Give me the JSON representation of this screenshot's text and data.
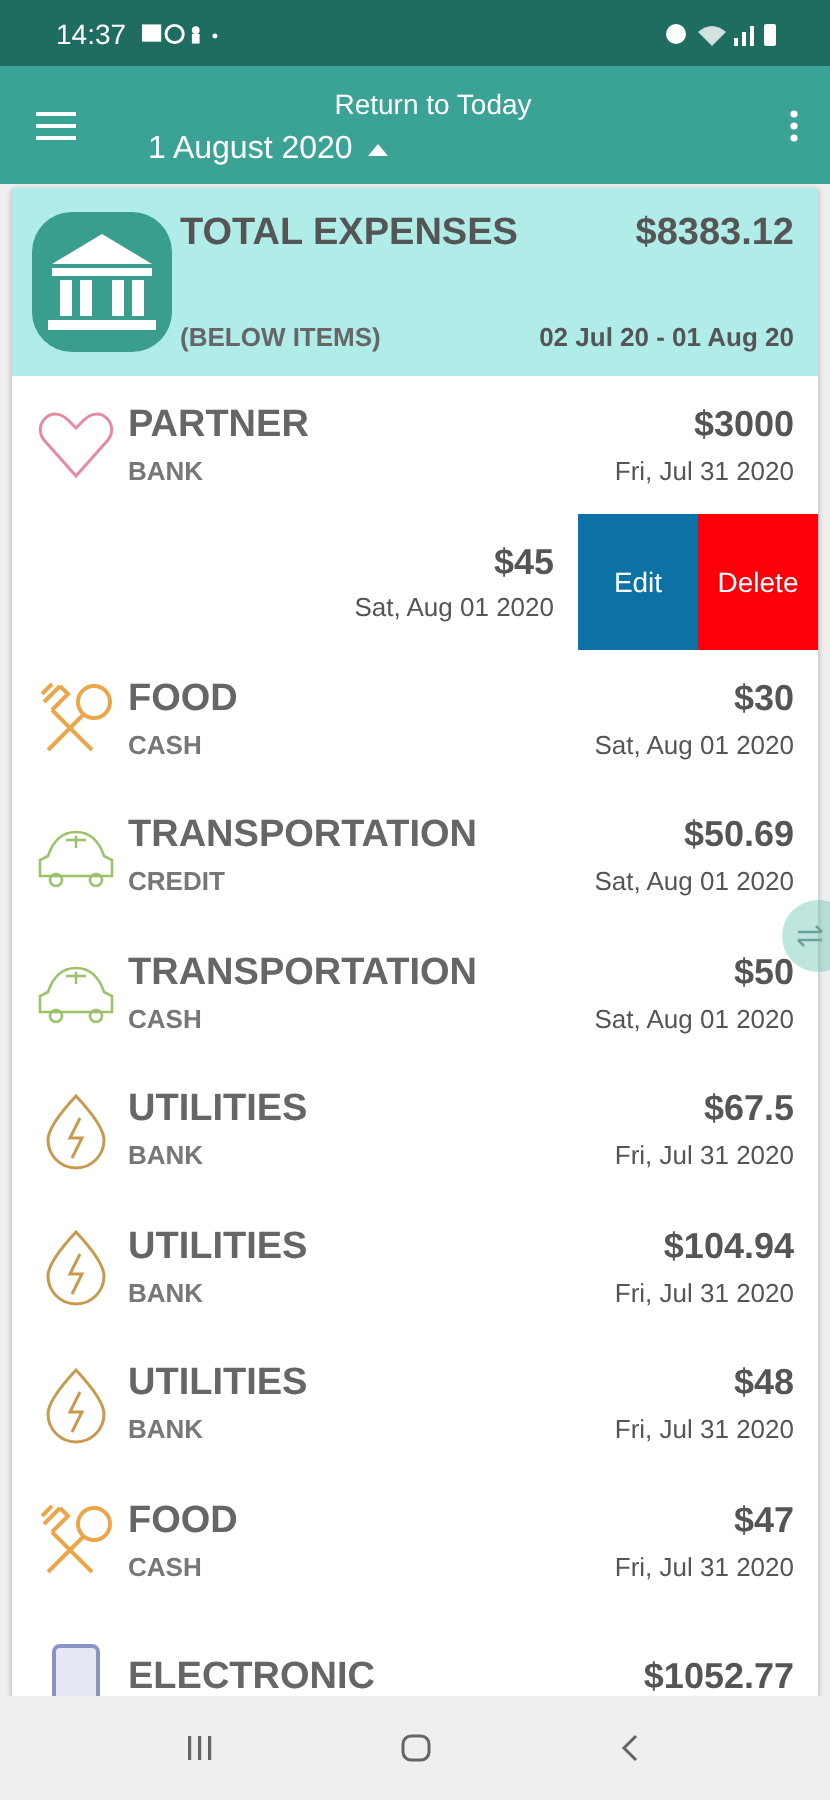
{
  "status_bar": {
    "time": "14:37"
  },
  "app_bar": {
    "title": "Return to Today",
    "date": "1 August 2020"
  },
  "summary": {
    "title": "TOTAL EXPENSES",
    "amount": "$8383.12",
    "subtitle": "(BELOW ITEMS)",
    "range": "02 Jul 20 - 01 Aug 20"
  },
  "items": [
    {
      "kind": "heart",
      "name": "PARTNER",
      "account": "BANK",
      "amount": "$3000",
      "date": "Fri, Jul 31 2020"
    },
    {
      "kind": "swiped",
      "amount": "$45",
      "date": "Sat, Aug 01 2020",
      "actions": [
        "Edit",
        "Delete"
      ]
    },
    {
      "kind": "food",
      "name": "FOOD",
      "account": "CASH",
      "amount": "$30",
      "date": "Sat, Aug 01 2020"
    },
    {
      "kind": "car",
      "name": "TRANSPORTATION",
      "account": "CREDIT",
      "amount": "$50.69",
      "date": "Sat, Aug 01 2020"
    },
    {
      "kind": "car",
      "name": "TRANSPORTATION",
      "account": "CASH",
      "amount": "$50",
      "date": "Sat, Aug 01 2020"
    },
    {
      "kind": "bolt",
      "name": "UTILITIES",
      "account": "BANK",
      "amount": "$67.5",
      "date": "Fri, Jul 31 2020"
    },
    {
      "kind": "bolt",
      "name": "UTILITIES",
      "account": "BANK",
      "amount": "$104.94",
      "date": "Fri, Jul 31 2020"
    },
    {
      "kind": "bolt",
      "name": "UTILITIES",
      "account": "BANK",
      "amount": "$48",
      "date": "Fri, Jul 31 2020"
    },
    {
      "kind": "food",
      "name": "FOOD",
      "account": "CASH",
      "amount": "$47",
      "date": "Fri, Jul 31 2020"
    },
    {
      "kind": "device",
      "name": "ELECTRONIC",
      "amount": "$1052.77"
    }
  ]
}
